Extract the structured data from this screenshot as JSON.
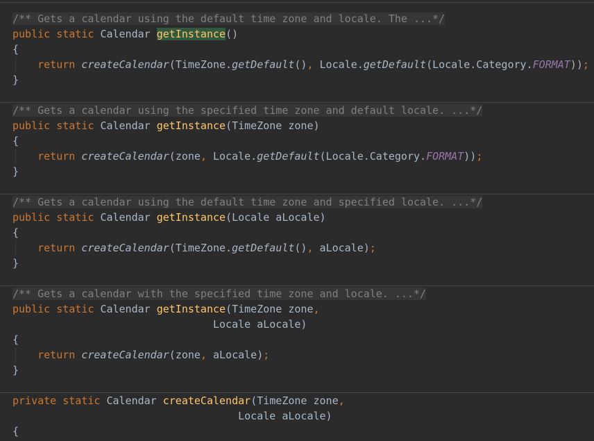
{
  "code": {
    "language": "Java",
    "blocks": [
      {
        "comment": "/** Gets a calendar using the default time zone and locale. The ...*/",
        "signature": {
          "modifiers": "public static",
          "return_type": "Calendar",
          "method": "getInstance",
          "params_line1": "()"
        },
        "body": {
          "open_brace": "{",
          "keyword": "return",
          "call": "createCalendar",
          "args": [
            {
              "object": "TimeZone.",
              "method": "getDefault",
              "suffix": "()"
            },
            {
              "object": "Locale.",
              "method": "getDefault",
              "inner_prefix": "(Locale.Category.",
              "inner_const": "FORMAT",
              "suffix": ")"
            }
          ],
          "close": ")",
          "semicolon": ";",
          "close_brace": "}"
        }
      },
      {
        "comment": "/** Gets a calendar using the specified time zone and default locale. ...*/",
        "signature": {
          "modifiers": "public static",
          "return_type": "Calendar",
          "method": "getInstance",
          "params_line1": "(TimeZone zone)"
        },
        "body": {
          "open_brace": "{",
          "keyword": "return",
          "call": "createCalendar",
          "arg1": "zone",
          "arg2_object": "Locale.",
          "arg2_method": "getDefault",
          "arg2_inner_prefix": "(Locale.Category.",
          "arg2_const": "FORMAT",
          "arg2_suffix": ")",
          "close": ")",
          "semicolon": ";",
          "close_brace": "}"
        }
      },
      {
        "comment": "/** Gets a calendar using the default time zone and specified locale. ...*/",
        "signature": {
          "modifiers": "public static",
          "return_type": "Calendar",
          "method": "getInstance",
          "params_line1": "(Locale aLocale)"
        },
        "body": {
          "open_brace": "{",
          "keyword": "return",
          "call": "createCalendar",
          "arg1_object": "TimeZone.",
          "arg1_method": "getDefault",
          "arg1_suffix": "()",
          "arg2": "aLocale",
          "close": ")",
          "semicolon": ";",
          "close_brace": "}"
        }
      },
      {
        "comment": "/** Gets a calendar with the specified time zone and locale. ...*/",
        "signature": {
          "modifiers": "public static",
          "return_type": "Calendar",
          "method": "getInstance",
          "params_line1": "(TimeZone zone",
          "params_line2": "Locale aLocale)"
        },
        "body": {
          "open_brace": "{",
          "keyword": "return",
          "call": "createCalendar",
          "arg1": "zone",
          "arg2": "aLocale",
          "close": ")",
          "semicolon": ";",
          "close_brace": "}"
        }
      },
      {
        "signature": {
          "modifiers": "private static",
          "return_type": "Calendar",
          "method": "createCalendar",
          "params_line1": "(TimeZone zone",
          "params_line2": "Locale aLocale)"
        },
        "body": {
          "open_brace": "{"
        }
      }
    ],
    "comma": ",",
    "open_paren": "("
  },
  "colors": {
    "background": "#2b2b2b",
    "keyword": "#cc7832",
    "method_declaration": "#ffc66d",
    "comment": "#808080",
    "constant": "#9876aa",
    "default_text": "#a9b7c6",
    "usage_highlight": "#32593d"
  }
}
